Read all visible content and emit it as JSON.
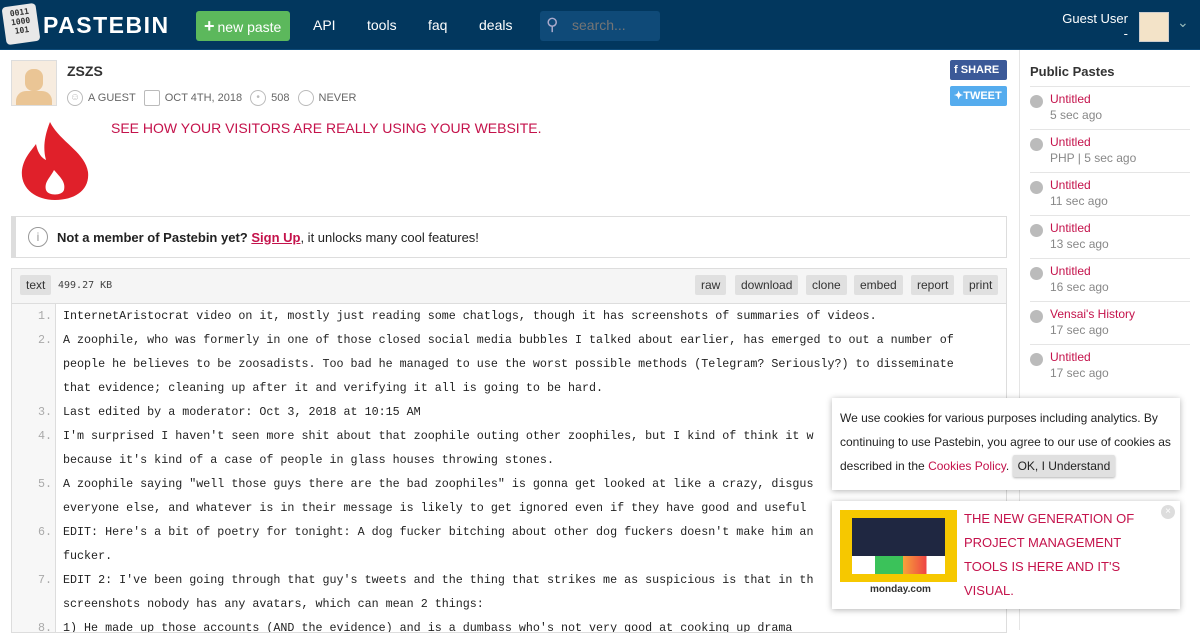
{
  "header": {
    "logo_text": "0011 1000 101",
    "brand": "PASTEBIN",
    "new_paste": "new paste",
    "nav": [
      "API",
      "tools",
      "faq",
      "deals"
    ],
    "search_placeholder": "search...",
    "user": "Guest User",
    "user_sub": "-"
  },
  "paste": {
    "title": "ZSZS",
    "author": "A GUEST",
    "date": "OCT 4TH, 2018",
    "views": "508",
    "expires": "NEVER",
    "share": "SHARE",
    "tweet": "TWEET",
    "syntax": "text",
    "size": "499.27 KB",
    "actions": [
      "raw",
      "download",
      "clone",
      "embed",
      "report",
      "print"
    ]
  },
  "ad_line": "SEE HOW YOUR VISITORS ARE REALLY USING YOUR WEBSITE.",
  "notice": {
    "lead": "Not a member of Pastebin yet?",
    "link": "Sign Up",
    "rest": ", it unlocks many cool features!"
  },
  "code_lines": [
    {
      "n": "1.",
      "segs": [
        "InternetAristocrat video on it, mostly just reading some chatlogs, though it has screenshots of summaries of videos."
      ]
    },
    {
      "n": "2.",
      "segs": [
        "A zoophile, who was formerly in one of those closed social media bubbles I talked about earlier, has emerged to out a number of",
        "people he believes to be zoosadists. Too bad he managed to use the worst possible methods (Telegram? Seriously?) to disseminate",
        "that evidence; cleaning up after it and verifying it all is going to be hard."
      ]
    },
    {
      "n": "3.",
      "segs": [
        "Last edited by a moderator: Oct 3, 2018 at 10:15 AM"
      ]
    },
    {
      "n": "4.",
      "segs": [
        "I'm surprised I haven't seen more shit about that zoophile outing other zoophiles, but I kind of think it w",
        "because it's kind of a case of people in glass houses throwing stones."
      ]
    },
    {
      "n": "5.",
      "segs": [
        "A zoophile saying \"well those guys there are the bad zoophiles\" is gonna get looked at like a crazy, disgus",
        "everyone else, and whatever is in their message is likely to get ignored even if they have good and useful"
      ]
    },
    {
      "n": "6.",
      "segs": [
        "EDIT: Here's a bit of poetry for tonight: A dog fucker bitching about other dog fuckers doesn't make him an",
        "fucker."
      ]
    },
    {
      "n": "7.",
      "segs": [
        "EDIT 2: I've been going through that guy's tweets and the thing that strikes me as suspicious is that in th",
        "screenshots nobody has any avatars, which can mean 2 things:"
      ]
    },
    {
      "n": "8.",
      "segs": [
        "1) He made up those accounts (AND the evidence) and is a dumbass who's not very good at cooking up drama"
      ]
    }
  ],
  "sidebar": {
    "title": "Public Pastes",
    "items": [
      {
        "title": "Untitled",
        "sub": "5 sec ago"
      },
      {
        "title": "Untitled",
        "sub": "PHP | 5 sec ago"
      },
      {
        "title": "Untitled",
        "sub": "11 sec ago"
      },
      {
        "title": "Untitled",
        "sub": "13 sec ago"
      },
      {
        "title": "Untitled",
        "sub": "16 sec ago"
      },
      {
        "title": "Vensai's History",
        "sub": "17 sec ago"
      },
      {
        "title": "Untitled",
        "sub": "17 sec ago"
      }
    ]
  },
  "cookie": {
    "text": "We use cookies for various purposes including analytics. By continuing to use Pastebin, you agree to our use of cookies as described in the ",
    "link": "Cookies Policy",
    "period": ".",
    "ok": "OK, I Understand"
  },
  "promo": {
    "text": "THE NEW GENERATION OF PROJECT MANAGEMENT TOOLS IS HERE AND IT'S VISUAL.",
    "brand": "monday.com",
    "close": "×"
  }
}
